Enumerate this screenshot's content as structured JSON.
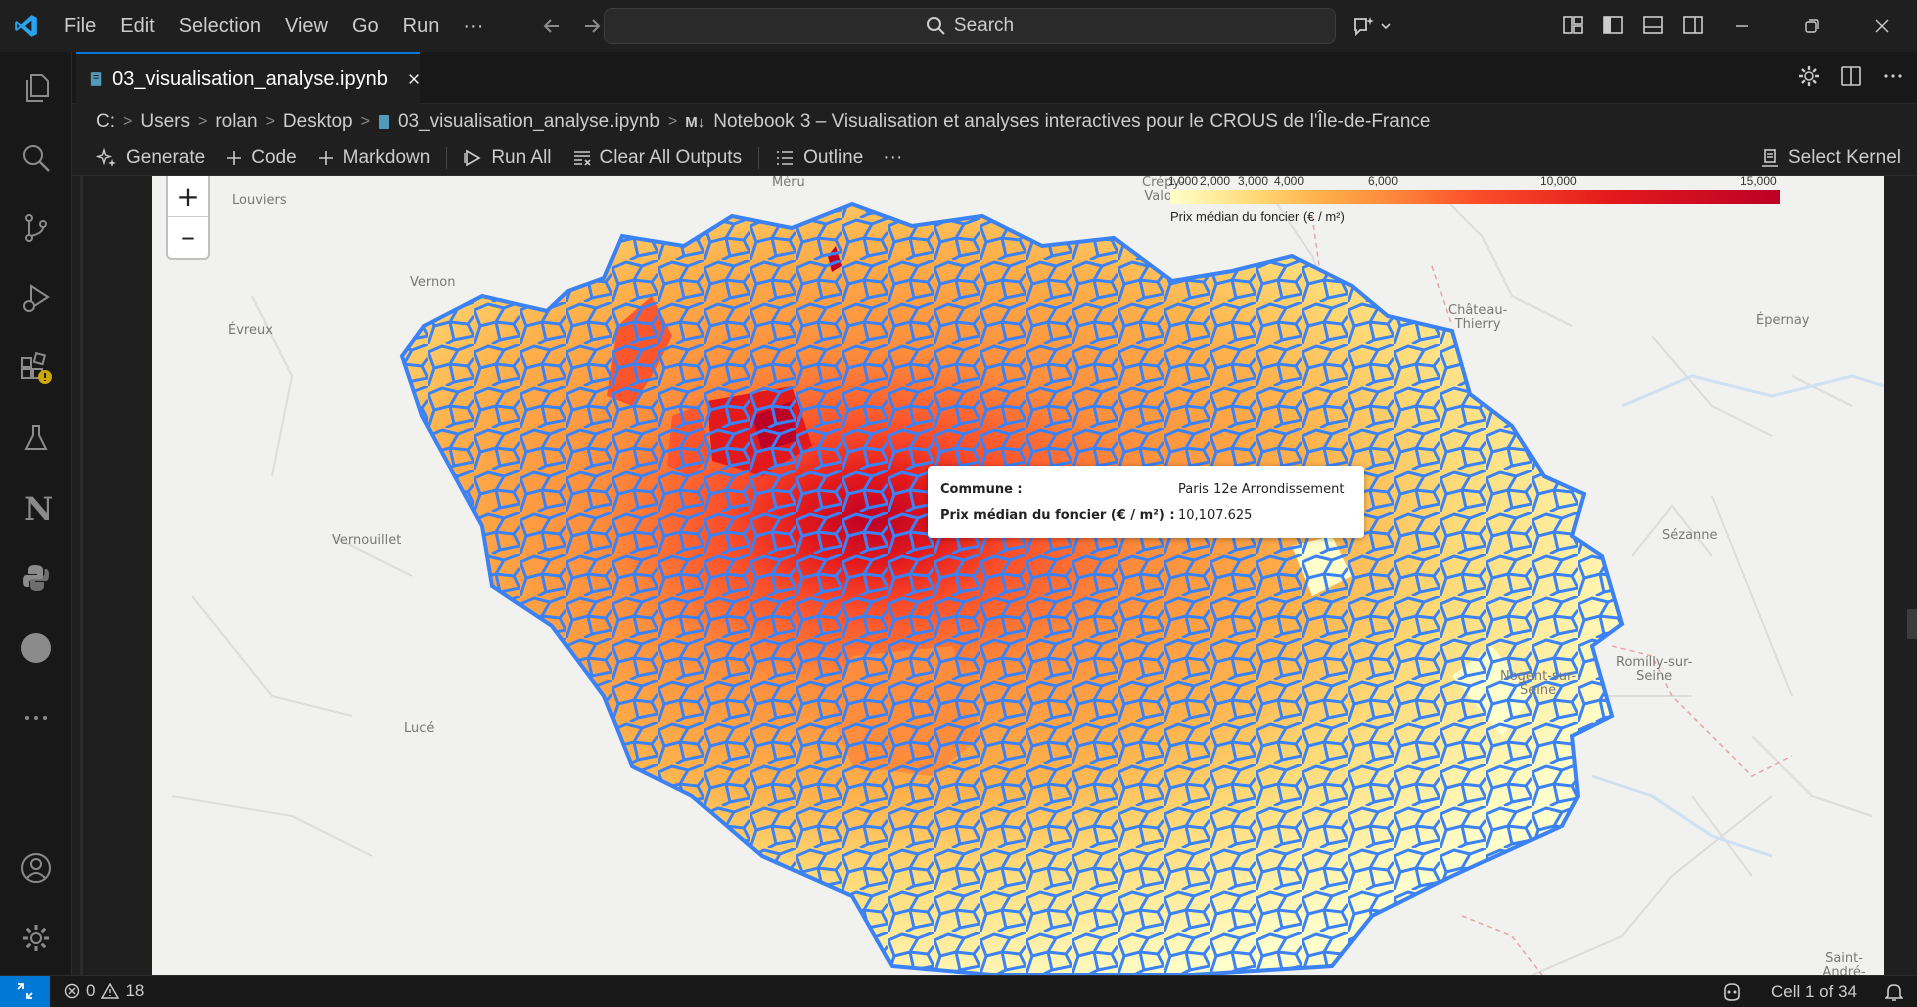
{
  "menu": [
    "File",
    "Edit",
    "Selection",
    "View",
    "Go",
    "Run",
    "···"
  ],
  "search": {
    "label": "Search"
  },
  "tab": {
    "filename": "03_visualisation_analyse.ipynb"
  },
  "breadcrumb": {
    "drive": "C:",
    "parts": [
      "Users",
      "rolan",
      "Desktop"
    ],
    "file": "03_visualisation_analyse.ipynb",
    "md_badge": "M↓",
    "heading": "Notebook 3 – Visualisation et analyses interactives pour le CROUS de l'Île-de-France"
  },
  "toolbar": {
    "generate": "Generate",
    "code": "Code",
    "markdown": "Markdown",
    "run_all": "Run All",
    "clear_outputs": "Clear All Outputs",
    "outline": "Outline",
    "more": "···",
    "select_kernel": "Select Kernel"
  },
  "map": {
    "zoom_in": "+",
    "zoom_out": "–",
    "places": {
      "louviers": "Louviers",
      "meru": "Méru",
      "vernon": "Vernon",
      "evreux": "Évreux",
      "chateau_thierry": "Château-\nThierry",
      "epernay": "Épernay",
      "vernouillet": "Vernouillet",
      "sezanne": "Sézanne",
      "romilly": "Romilly-sur-\nSeine",
      "nogent": "Nogent-sur-\nSeine",
      "luce": "Lucé",
      "crepy": "Crépy-\nValois",
      "saint_andre": "Saint-André-"
    },
    "legend": {
      "ticks": [
        "1,000",
        "2,000",
        "3,000",
        "4,000",
        "6,000",
        "10,000",
        "15,000"
      ],
      "caption": "Prix médian du foncier (€ / m²)",
      "colors": [
        "#ffffcc",
        "#ffeda0",
        "#fed976",
        "#feb24c",
        "#fd8d3c",
        "#fc4e2a",
        "#e31a1c",
        "#bd0026"
      ]
    },
    "tooltip": {
      "commune_label": "Commune :",
      "commune_value": "Paris 12e Arrondissement",
      "price_label": "Prix médian du foncier (€ / m²) :",
      "price_value": "10,107.625"
    },
    "border_color": "#3b82f6"
  },
  "status": {
    "errors": "0",
    "warnings": "18",
    "cell": "Cell 1 of 34"
  },
  "colors": {
    "accent": "#0078d4",
    "warning": "#cca700"
  }
}
